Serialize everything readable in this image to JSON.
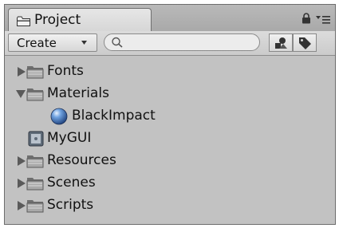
{
  "panel": {
    "tab_title": "Project",
    "icons": {
      "tab": "folder-icon",
      "lock": "lock-icon",
      "menu": "menu-icon"
    }
  },
  "toolbar": {
    "create_label": "Create",
    "search_placeholder": "",
    "icons": {
      "filter_type": "shapes-icon",
      "filter_label": "tag-icon"
    }
  },
  "tree": [
    {
      "label": "Fonts",
      "depth": 0,
      "icon": "folder-icon",
      "expand": "collapsed"
    },
    {
      "label": "Materials",
      "depth": 0,
      "icon": "folder-icon",
      "expand": "expanded"
    },
    {
      "label": "BlackImpact",
      "depth": 1,
      "icon": "material-sphere-icon",
      "expand": "none"
    },
    {
      "label": "MyGUI",
      "depth": 0,
      "icon": "asset-icon",
      "expand": "none"
    },
    {
      "label": "Resources",
      "depth": 0,
      "icon": "folder-icon",
      "expand": "collapsed"
    },
    {
      "label": "Scenes",
      "depth": 0,
      "icon": "folder-icon",
      "expand": "collapsed"
    },
    {
      "label": "Scripts",
      "depth": 0,
      "icon": "folder-icon",
      "expand": "collapsed"
    }
  ]
}
